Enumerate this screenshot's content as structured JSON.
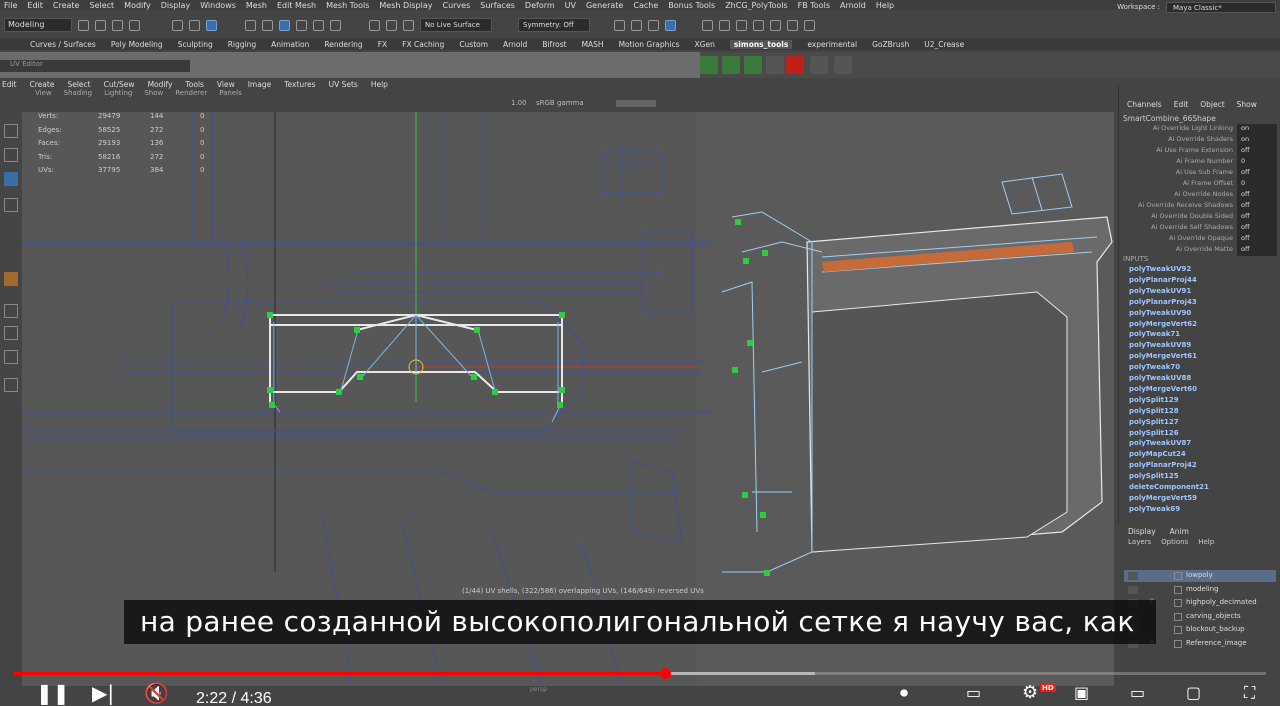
{
  "menu": [
    "File",
    "Edit",
    "Create",
    "Select",
    "Modify",
    "Display",
    "Windows",
    "Mesh",
    "Edit Mesh",
    "Mesh Tools",
    "Mesh Display",
    "Curves",
    "Surfaces",
    "Deform",
    "UV",
    "Generate",
    "Cache",
    "Bonus Tools",
    "ZhCG_PolyTools",
    "FB Tools",
    "Arnold",
    "Help"
  ],
  "workspace": {
    "label": "Workspace :",
    "value": "Maya Classic*"
  },
  "mode": "Modeling",
  "live_surface": "No Live Surface",
  "symmetry": "Symmetry: Off",
  "shelf_tabs": [
    "Curves / Surfaces",
    "Poly Modeling",
    "Sculpting",
    "Rigging",
    "Animation",
    "Rendering",
    "FX",
    "FX Caching",
    "Custom",
    "Arnold",
    "Bifrost",
    "MASH",
    "Motion Graphics",
    "XGen",
    "simons_tools",
    "experimental",
    "GoZBrush",
    "U2_Crease"
  ],
  "active_shelf_tab": "simons_tools",
  "uv_editor": {
    "title": "UV Editor",
    "menu": [
      "Edit",
      "Create",
      "Select",
      "Cut/Sew",
      "Modify",
      "Tools",
      "View",
      "Image",
      "Textures",
      "UV Sets",
      "Help"
    ],
    "submenu": [
      "View",
      "Shading",
      "Lighting",
      "Show",
      "Renderer",
      "Panels"
    ],
    "gamma": "1.00",
    "gamma_label": "sRGB gamma",
    "stats": [
      {
        "label": "Verts:",
        "a": "29479",
        "b": "144",
        "c": "0"
      },
      {
        "label": "Edges:",
        "a": "58525",
        "b": "272",
        "c": "0"
      },
      {
        "label": "Faces:",
        "a": "29193",
        "b": "136",
        "c": "0"
      },
      {
        "label": "Tris:",
        "a": "58216",
        "b": "272",
        "c": "0"
      },
      {
        "label": "UVs:",
        "a": "37795",
        "b": "384",
        "c": "0"
      }
    ],
    "message": "(1/44) UV shells, (322/586) overlapping UVs, (146/649) reversed UVs"
  },
  "viewport_label": "persp",
  "channel_box": {
    "tabs": [
      "Channels",
      "Edit",
      "Object",
      "Show"
    ],
    "object": "SmartCombine_66Shape",
    "attributes": [
      {
        "name": "Ai Override Light Linking",
        "value": "on"
      },
      {
        "name": "Ai Override Shaders",
        "value": "on"
      },
      {
        "name": "Ai Use Frame Extension",
        "value": "off"
      },
      {
        "name": "Ai Frame Number",
        "value": "0"
      },
      {
        "name": "Ai Use Sub Frame",
        "value": "off"
      },
      {
        "name": "Ai Frame Offset",
        "value": "0"
      },
      {
        "name": "Ai Override Nodes",
        "value": "off"
      },
      {
        "name": "Ai Override Receive Shadows",
        "value": "off"
      },
      {
        "name": "Ai Override Double Sided",
        "value": "off"
      },
      {
        "name": "Ai Override Self Shadows",
        "value": "off"
      },
      {
        "name": "Ai Override Opaque",
        "value": "off"
      },
      {
        "name": "Ai Override Matte",
        "value": "off"
      }
    ],
    "inputs_label": "INPUTS",
    "inputs": [
      "polyTweakUV92",
      "polyPlanarProj44",
      "polyTweakUV91",
      "polyPlanarProj43",
      "polyTweakUV90",
      "polyMergeVert62",
      "polyTweak71",
      "polyTweakUV89",
      "polyMergeVert61",
      "polyTweak70",
      "polyTweakUV88",
      "polyMergeVert60",
      "polySplit129",
      "polySplit128",
      "polySplit127",
      "polySplit126",
      "polyTweakUV87",
      "polyMapCut24",
      "polyPlanarProj42",
      "polySplit125",
      "deleteComponent21",
      "polyMergeVert59",
      "polyTweak69"
    ]
  },
  "layers": {
    "tabs": [
      "Display",
      "Anim"
    ],
    "sub": [
      "Layers",
      "Options",
      "Help"
    ],
    "items": [
      {
        "name": "lowpoly",
        "flag": "",
        "selected": true
      },
      {
        "name": "modeling",
        "flag": "",
        "selected": false
      },
      {
        "name": "highpoly_decimated",
        "flag": "P",
        "selected": false
      },
      {
        "name": "carving_objects",
        "flag": "",
        "selected": false
      },
      {
        "name": "blockout_backup",
        "flag": "",
        "selected": false
      },
      {
        "name": "Reference_image",
        "flag": "R",
        "selected": false
      }
    ]
  },
  "subtitle": "на ранее созданной высокополигональной сетке я научу вас, как",
  "player": {
    "time": "2:22 / 4:36",
    "progress": 0.52,
    "buffered": 0.64,
    "hd": "HD"
  },
  "colors": {
    "accent": "#ff0000",
    "uv_wire": "#3a4fa8",
    "uv_selected": "#2ecc40",
    "mesh_edge": "#74b7e8"
  }
}
